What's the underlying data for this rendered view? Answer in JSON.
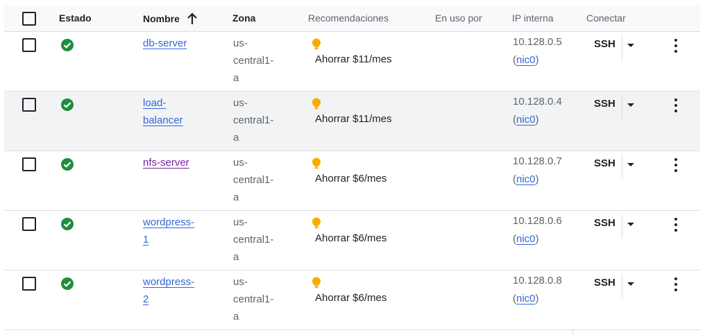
{
  "header": {
    "estado": "Estado",
    "nombre": "Nombre",
    "zona": "Zona",
    "recomendaciones": "Recomendaciones",
    "en_uso_por": "En uso por",
    "ip_interna": "IP interna",
    "conectar": "Conectar",
    "sort_icon": "arrow-up-icon"
  },
  "colors": {
    "link": "#3367d6",
    "visited_link": "#7b1fa2",
    "status_ok": "#1e8e3e",
    "bulb": "#f9ab00"
  },
  "rows": [
    {
      "name_lines": [
        "db-server"
      ],
      "zone_lines": [
        "us-",
        "central1-",
        "a"
      ],
      "recommendation": "Ahorrar $11/mes",
      "ip": "10.128.0.5",
      "nic": "nic0",
      "ssh": "SSH",
      "visited": false
    },
    {
      "name_lines": [
        "load-",
        "balancer"
      ],
      "zone_lines": [
        "us-",
        "central1-",
        "a"
      ],
      "recommendation": "Ahorrar $11/mes",
      "ip": "10.128.0.4",
      "nic": "nic0",
      "ssh": "SSH",
      "visited": false
    },
    {
      "name_lines": [
        "nfs-server"
      ],
      "zone_lines": [
        "us-",
        "central1-",
        "a"
      ],
      "recommendation": "Ahorrar $6/mes",
      "ip": "10.128.0.7",
      "nic": "nic0",
      "ssh": "SSH",
      "visited": true
    },
    {
      "name_lines": [
        "wordpress-",
        "1"
      ],
      "zone_lines": [
        "us-",
        "central1-",
        "a"
      ],
      "recommendation": "Ahorrar $6/mes",
      "ip": "10.128.0.6",
      "nic": "nic0",
      "ssh": "SSH",
      "visited": false
    },
    {
      "name_lines": [
        "wordpress-",
        "2"
      ],
      "zone_lines": [
        "us-",
        "central1-",
        "a"
      ],
      "recommendation": "Ahorrar $6/mes",
      "ip": "10.128.0.8",
      "nic": "nic0",
      "ssh": "SSH",
      "visited": false
    }
  ]
}
